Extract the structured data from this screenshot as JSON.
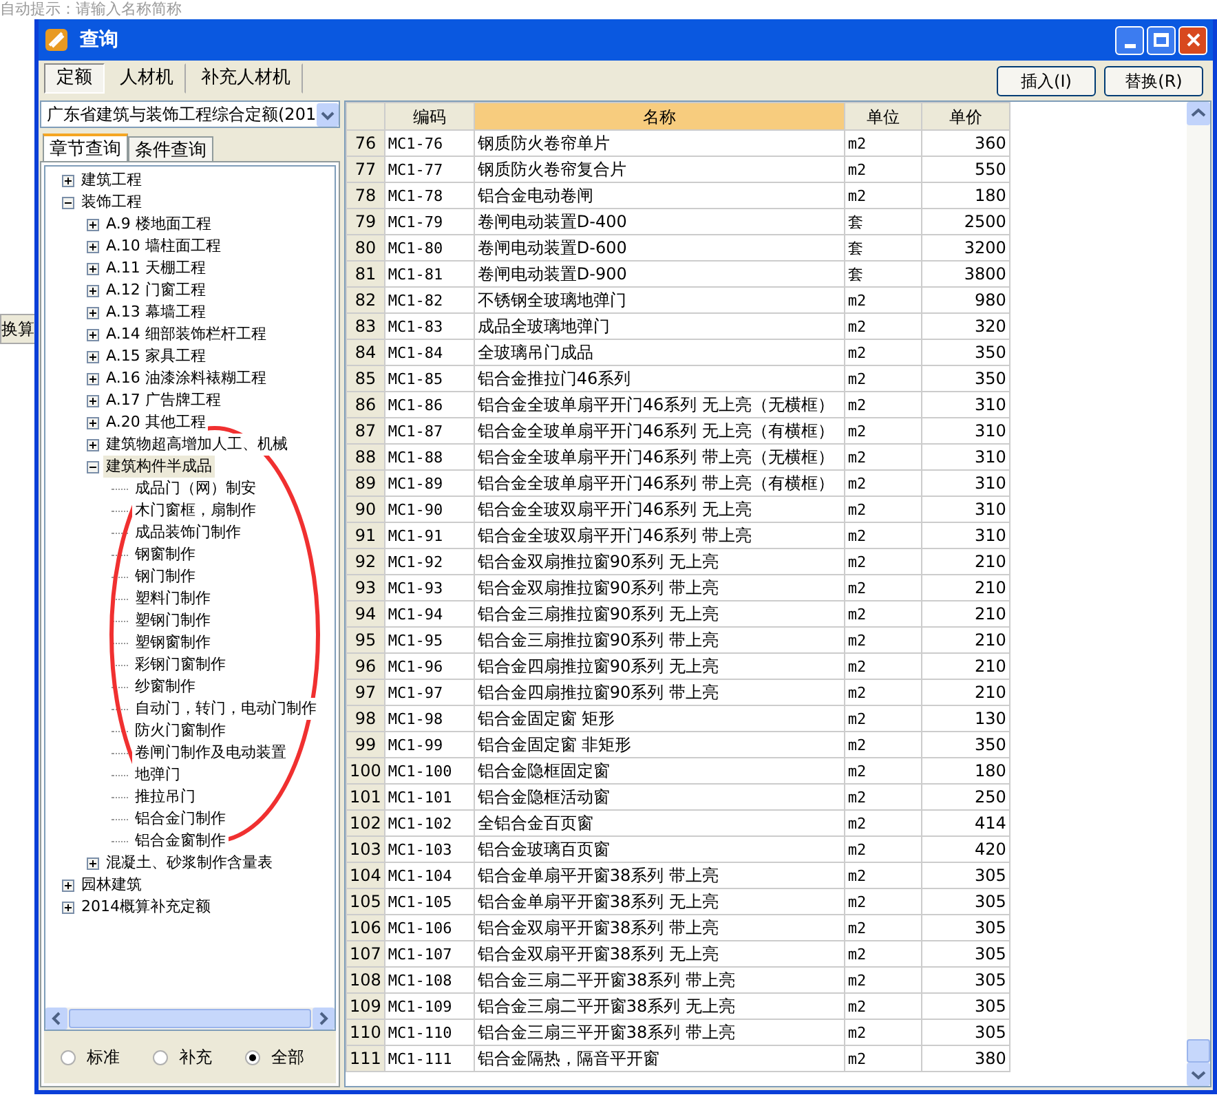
{
  "background": {
    "hint": "自动提示：请输入名称简称",
    "side_button": "换算"
  },
  "window": {
    "title": "查询"
  },
  "tabs": [
    {
      "label": "定额",
      "selected": true
    },
    {
      "label": "人材机",
      "selected": false
    },
    {
      "label": "补充人材机",
      "selected": false
    }
  ],
  "buttons": [
    "插入(I)",
    "替换(R)"
  ],
  "library_select": {
    "value": "广东省建筑与装饰工程综合定额(201"
  },
  "sub_tabs": [
    {
      "label": "章节查询",
      "selected": true
    },
    {
      "label": "条件查询",
      "selected": false
    }
  ],
  "tree": [
    {
      "label": "建筑工程",
      "expanded": false,
      "selected": false
    },
    {
      "label": "装饰工程",
      "expanded": true,
      "selected": false,
      "children": [
        {
          "label": "A.9  楼地面工程",
          "expanded": false,
          "selected": false
        },
        {
          "label": "A.10  墙柱面工程",
          "expanded": false,
          "selected": false
        },
        {
          "label": "A.11  天棚工程",
          "expanded": false,
          "selected": false
        },
        {
          "label": "A.12  门窗工程",
          "expanded": false,
          "selected": false
        },
        {
          "label": "A.13  幕墙工程",
          "expanded": false,
          "selected": false
        },
        {
          "label": "A.14  细部装饰栏杆工程",
          "expanded": false,
          "selected": false
        },
        {
          "label": "A.15  家具工程",
          "expanded": false,
          "selected": false
        },
        {
          "label": "A.16  油漆涂料裱糊工程",
          "expanded": false,
          "selected": false
        },
        {
          "label": "A.17  广告牌工程",
          "expanded": false,
          "selected": false
        },
        {
          "label": "A.20  其他工程",
          "expanded": false,
          "selected": false
        },
        {
          "label": "建筑物超高增加人工、机械",
          "expanded": false,
          "selected": false
        },
        {
          "label": "建筑构件半成品",
          "expanded": true,
          "selected": true,
          "children": [
            {
              "label": "成品门（网）制安",
              "selected": false
            },
            {
              "label": "木门窗框，扇制作",
              "selected": false
            },
            {
              "label": "成品装饰门制作",
              "selected": false
            },
            {
              "label": "钢窗制作",
              "selected": false
            },
            {
              "label": "钢门制作",
              "selected": false
            },
            {
              "label": "塑料门制作",
              "selected": false
            },
            {
              "label": "塑钢门制作",
              "selected": false
            },
            {
              "label": "塑钢窗制作",
              "selected": false
            },
            {
              "label": "彩钢门窗制作",
              "selected": false
            },
            {
              "label": "纱窗制作",
              "selected": false
            },
            {
              "label": "自动门，转门，电动门制作",
              "selected": false
            },
            {
              "label": "防火门窗制作",
              "selected": false
            },
            {
              "label": "卷闸门制作及电动装置",
              "selected": false
            },
            {
              "label": "地弹门",
              "selected": false
            },
            {
              "label": "推拉吊门",
              "selected": false
            },
            {
              "label": "铝合金门制作",
              "selected": false
            },
            {
              "label": "铝合金窗制作",
              "selected": false
            }
          ]
        },
        {
          "label": "混凝土、砂浆制作含量表",
          "expanded": false,
          "selected": false
        }
      ]
    },
    {
      "label": "园林建筑",
      "expanded": false,
      "selected": false
    },
    {
      "label": "2014概算补充定额",
      "expanded": false,
      "selected": false
    }
  ],
  "radios": [
    {
      "label": "标准",
      "selected": false
    },
    {
      "label": "补充",
      "selected": false
    },
    {
      "label": "全部",
      "selected": true
    }
  ],
  "table": {
    "columns": [
      "",
      "编码",
      "名称",
      "单位",
      "单价"
    ],
    "rows": [
      [
        "76",
        "MC1-76",
        "钢质防火卷帘单片",
        "m2",
        "360"
      ],
      [
        "77",
        "MC1-77",
        "钢质防火卷帘复合片",
        "m2",
        "550"
      ],
      [
        "78",
        "MC1-78",
        "铝合金电动卷闸",
        "m2",
        "180"
      ],
      [
        "79",
        "MC1-79",
        "卷闸电动装置D-400",
        "套",
        "2500"
      ],
      [
        "80",
        "MC1-80",
        "卷闸电动装置D-600",
        "套",
        "3200"
      ],
      [
        "81",
        "MC1-81",
        "卷闸电动装置D-900",
        "套",
        "3800"
      ],
      [
        "82",
        "MC1-82",
        "不锈钢全玻璃地弹门",
        "m2",
        "980"
      ],
      [
        "83",
        "MC1-83",
        "成品全玻璃地弹门",
        "m2",
        "320"
      ],
      [
        "84",
        "MC1-84",
        "全玻璃吊门成品",
        "m2",
        "350"
      ],
      [
        "85",
        "MC1-85",
        "铝合金推拉门46系列",
        "m2",
        "350"
      ],
      [
        "86",
        "MC1-86",
        "铝合金全玻单扇平开门46系列 无上亮（无横框）",
        "m2",
        "310"
      ],
      [
        "87",
        "MC1-87",
        "铝合金全玻单扇平开门46系列 无上亮（有横框）",
        "m2",
        "310"
      ],
      [
        "88",
        "MC1-88",
        "铝合金全玻单扇平开门46系列 带上亮（无横框）",
        "m2",
        "310"
      ],
      [
        "89",
        "MC1-89",
        "铝合金全玻单扇平开门46系列 带上亮（有横框）",
        "m2",
        "310"
      ],
      [
        "90",
        "MC1-90",
        "铝合金全玻双扇平开门46系列 无上亮",
        "m2",
        "310"
      ],
      [
        "91",
        "MC1-91",
        "铝合金全玻双扇平开门46系列 带上亮",
        "m2",
        "310"
      ],
      [
        "92",
        "MC1-92",
        "铝合金双扇推拉窗90系列 无上亮",
        "m2",
        "210"
      ],
      [
        "93",
        "MC1-93",
        "铝合金双扇推拉窗90系列 带上亮",
        "m2",
        "210"
      ],
      [
        "94",
        "MC1-94",
        "铝合金三扇推拉窗90系列 无上亮",
        "m2",
        "210"
      ],
      [
        "95",
        "MC1-95",
        "铝合金三扇推拉窗90系列 带上亮",
        "m2",
        "210"
      ],
      [
        "96",
        "MC1-96",
        "铝合金四扇推拉窗90系列 无上亮",
        "m2",
        "210"
      ],
      [
        "97",
        "MC1-97",
        "铝合金四扇推拉窗90系列 带上亮",
        "m2",
        "210"
      ],
      [
        "98",
        "MC1-98",
        "铝合金固定窗 矩形",
        "m2",
        "130"
      ],
      [
        "99",
        "MC1-99",
        "铝合金固定窗 非矩形",
        "m2",
        "350"
      ],
      [
        "100",
        "MC1-100",
        "铝合金隐框固定窗",
        "m2",
        "180"
      ],
      [
        "101",
        "MC1-101",
        "铝合金隐框活动窗",
        "m2",
        "250"
      ],
      [
        "102",
        "MC1-102",
        "全铝合金百页窗",
        "m2",
        "414"
      ],
      [
        "103",
        "MC1-103",
        "铝合金玻璃百页窗",
        "m2",
        "420"
      ],
      [
        "104",
        "MC1-104",
        "铝合金单扇平开窗38系列 带上亮",
        "m2",
        "305"
      ],
      [
        "105",
        "MC1-105",
        "铝合金单扇平开窗38系列 无上亮",
        "m2",
        "305"
      ],
      [
        "106",
        "MC1-106",
        "铝合金双扇平开窗38系列 带上亮",
        "m2",
        "305"
      ],
      [
        "107",
        "MC1-107",
        "铝合金双扇平开窗38系列 无上亮",
        "m2",
        "305"
      ],
      [
        "108",
        "MC1-108",
        "铝合金三扇二平开窗38系列 带上亮",
        "m2",
        "305"
      ],
      [
        "109",
        "MC1-109",
        "铝合金三扇二平开窗38系列 无上亮",
        "m2",
        "305"
      ],
      [
        "110",
        "MC1-110",
        "铝合金三扇三平开窗38系列 带上亮",
        "m2",
        "305"
      ],
      [
        "111",
        "MC1-111",
        "铝合金隔热，隔音平开窗",
        "m2",
        "380"
      ]
    ]
  }
}
